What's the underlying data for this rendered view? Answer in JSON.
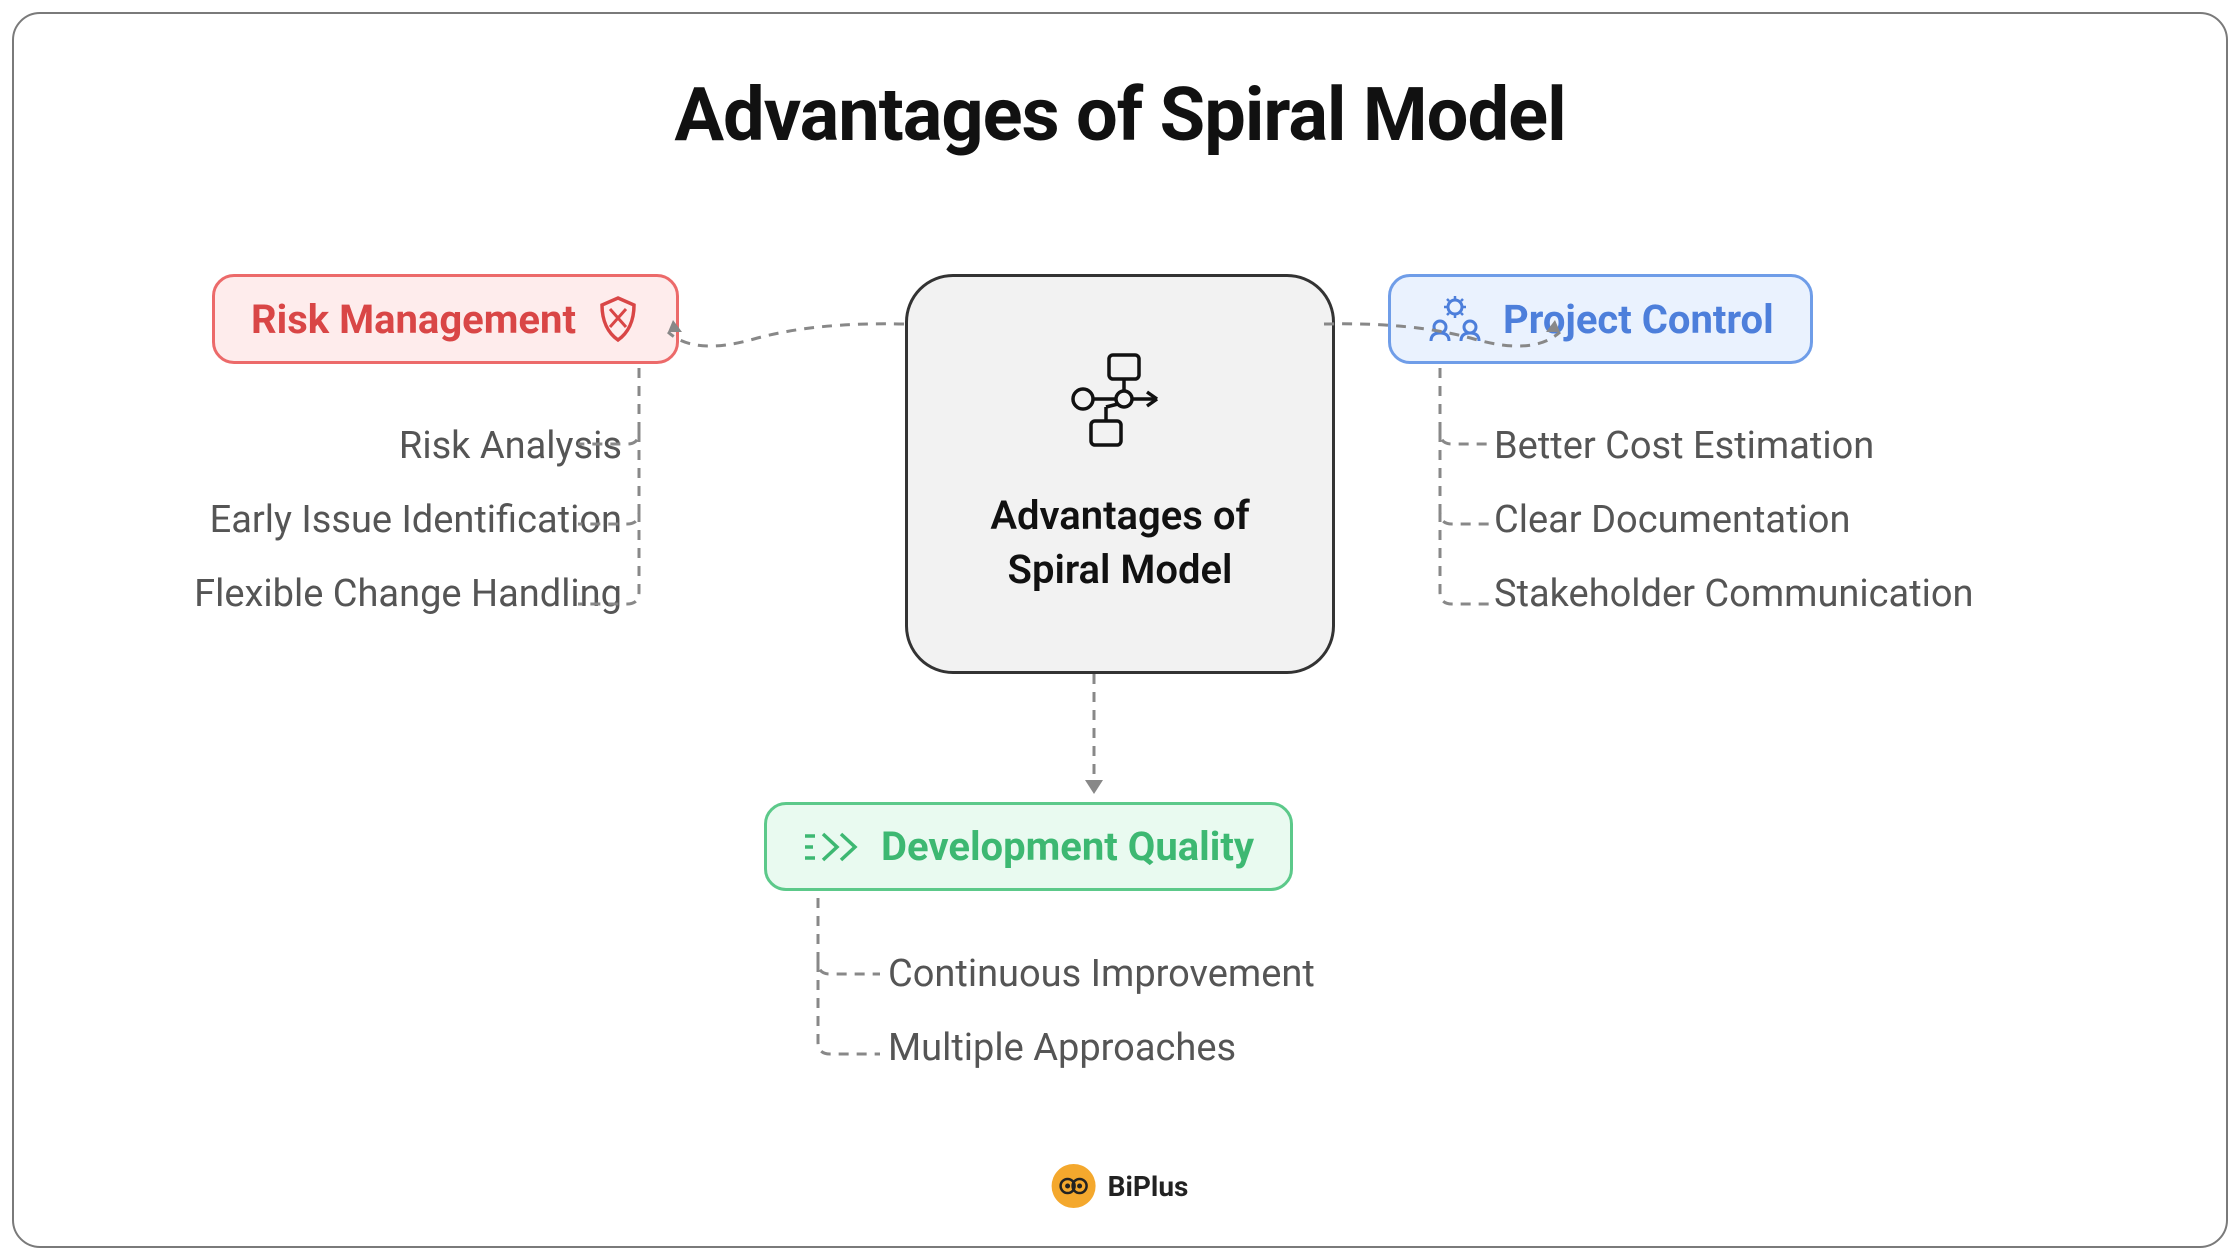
{
  "title": "Advantages of Spiral Model",
  "center": {
    "label": "Advantages of Spiral Model"
  },
  "categories": {
    "risk": {
      "label": "Risk Management",
      "items": [
        "Risk Analysis",
        "Early Issue Identification",
        "Flexible Change Handling"
      ]
    },
    "project": {
      "label": "Project Control",
      "items": [
        "Better Cost Estimation",
        "Clear Documentation",
        "Stakeholder Communication"
      ]
    },
    "dev": {
      "label": "Development Quality",
      "items": [
        "Continuous Improvement",
        "Multiple Approaches"
      ]
    }
  },
  "brand": "BiPlus"
}
